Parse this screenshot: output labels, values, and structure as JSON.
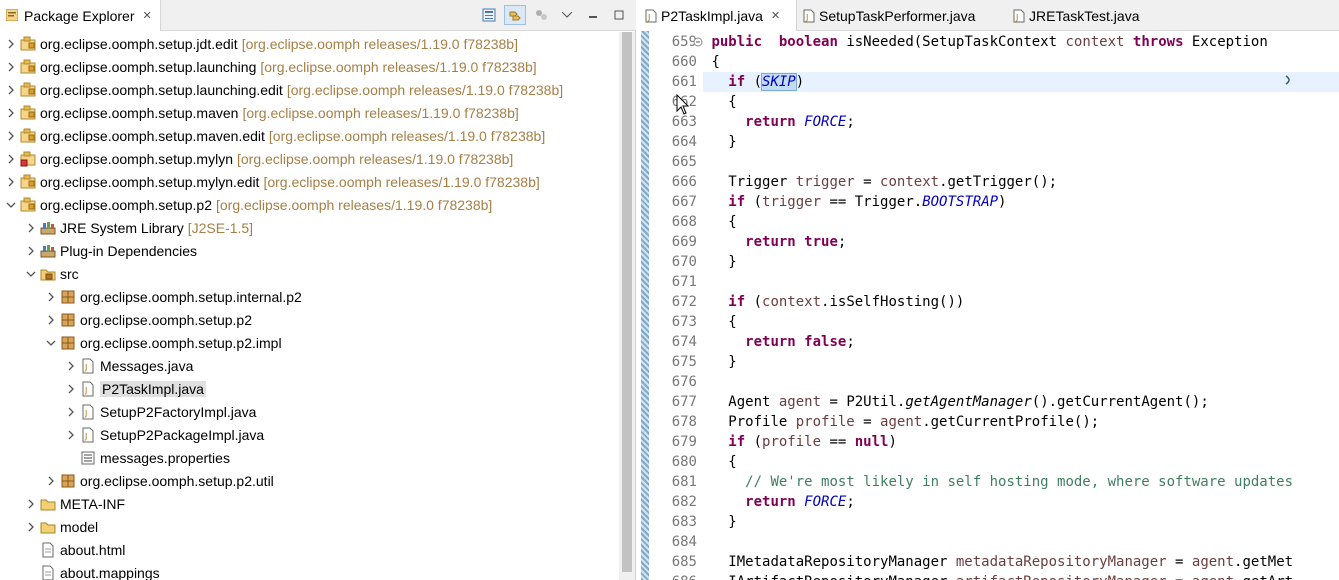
{
  "explorer": {
    "title": "Package Explorer",
    "close": "✕",
    "tree": [
      {
        "label": "org.eclipse.oomph.setup.jdt.edit",
        "decor": "[org.eclipse.oomph releases/1.19.0 f78238b]",
        "depth": 0,
        "expanded": false,
        "icon": "plugin-project-icon"
      },
      {
        "label": "org.eclipse.oomph.setup.launching",
        "decor": "[org.eclipse.oomph releases/1.19.0 f78238b]",
        "depth": 0,
        "expanded": false,
        "icon": "plugin-project-icon"
      },
      {
        "label": "org.eclipse.oomph.setup.launching.edit",
        "decor": "[org.eclipse.oomph releases/1.19.0 f78238b]",
        "depth": 0,
        "expanded": false,
        "icon": "plugin-project-icon"
      },
      {
        "label": "org.eclipse.oomph.setup.maven",
        "decor": "[org.eclipse.oomph releases/1.19.0 f78238b]",
        "depth": 0,
        "expanded": false,
        "icon": "plugin-project-icon"
      },
      {
        "label": "org.eclipse.oomph.setup.maven.edit",
        "decor": "[org.eclipse.oomph releases/1.19.0 f78238b]",
        "depth": 0,
        "expanded": false,
        "icon": "plugin-project-icon"
      },
      {
        "label": "org.eclipse.oomph.setup.mylyn",
        "decor": "[org.eclipse.oomph releases/1.19.0 f78238b]",
        "depth": 0,
        "expanded": false,
        "icon": "plugin-project-error-icon"
      },
      {
        "label": "org.eclipse.oomph.setup.mylyn.edit",
        "decor": "[org.eclipse.oomph releases/1.19.0 f78238b]",
        "depth": 0,
        "expanded": false,
        "icon": "plugin-project-icon"
      },
      {
        "label": "org.eclipse.oomph.setup.p2",
        "decor": "[org.eclipse.oomph releases/1.19.0 f78238b]",
        "depth": 0,
        "expanded": true,
        "icon": "plugin-project-icon"
      },
      {
        "label": "JRE System Library",
        "decor": "[J2SE-1.5]",
        "depth": 1,
        "expanded": false,
        "icon": "library-icon"
      },
      {
        "label": "Plug-in Dependencies",
        "decor": "",
        "depth": 1,
        "expanded": false,
        "icon": "library-icon"
      },
      {
        "label": "src",
        "decor": "",
        "depth": 1,
        "expanded": true,
        "icon": "source-folder-icon"
      },
      {
        "label": "org.eclipse.oomph.setup.internal.p2",
        "decor": "",
        "depth": 2,
        "expanded": false,
        "icon": "package-icon"
      },
      {
        "label": "org.eclipse.oomph.setup.p2",
        "decor": "",
        "depth": 2,
        "expanded": false,
        "icon": "package-icon"
      },
      {
        "label": "org.eclipse.oomph.setup.p2.impl",
        "decor": "",
        "depth": 2,
        "expanded": true,
        "icon": "package-icon"
      },
      {
        "label": "Messages.java",
        "decor": "",
        "depth": 3,
        "expanded": false,
        "icon": "java-file-icon"
      },
      {
        "label": "P2TaskImpl.java",
        "decor": "",
        "depth": 3,
        "expanded": false,
        "icon": "java-file-icon",
        "selected": true
      },
      {
        "label": "SetupP2FactoryImpl.java",
        "decor": "",
        "depth": 3,
        "expanded": false,
        "icon": "java-file-icon"
      },
      {
        "label": "SetupP2PackageImpl.java",
        "decor": "",
        "depth": 3,
        "expanded": false,
        "icon": "java-file-icon"
      },
      {
        "label": "messages.properties",
        "decor": "",
        "depth": 3,
        "expanded": null,
        "icon": "properties-file-icon"
      },
      {
        "label": "org.eclipse.oomph.setup.p2.util",
        "decor": "",
        "depth": 2,
        "expanded": false,
        "icon": "package-icon"
      },
      {
        "label": "META-INF",
        "decor": "",
        "depth": 1,
        "expanded": false,
        "icon": "folder-icon"
      },
      {
        "label": "model",
        "decor": "",
        "depth": 1,
        "expanded": false,
        "icon": "folder-icon"
      },
      {
        "label": "about.html",
        "decor": "",
        "depth": 1,
        "expanded": null,
        "icon": "file-icon"
      },
      {
        "label": "about.mappings",
        "decor": "",
        "depth": 1,
        "expanded": null,
        "icon": "file-icon"
      }
    ]
  },
  "editor": {
    "tabs": [
      {
        "label": "P2TaskImpl.java",
        "active": true
      },
      {
        "label": "SetupTaskPerformer.java",
        "active": false
      },
      {
        "label": "JRETaskTest.java",
        "active": false
      }
    ],
    "close": "✕",
    "lines": [
      {
        "n": "659",
        "fold": true,
        "tokens": [
          [
            "kw",
            "public"
          ],
          [
            "",
            "  "
          ],
          [
            "kw",
            "boolean"
          ],
          [
            "",
            " isNeeded(SetupTaskContext "
          ],
          [
            "var",
            "context"
          ],
          [
            "",
            " "
          ],
          [
            "kw",
            "throws"
          ],
          [
            "",
            " Exception"
          ]
        ]
      },
      {
        "n": "660",
        "tokens": [
          [
            "",
            "{"
          ]
        ]
      },
      {
        "n": "661",
        "current": true,
        "tokens": [
          [
            "",
            "  "
          ],
          [
            "kw",
            "if"
          ],
          [
            "",
            " ("
          ],
          [
            "fldhl",
            "SKIP"
          ],
          [
            "",
            ")"
          ]
        ]
      },
      {
        "n": "662",
        "tokens": [
          [
            "",
            "  {"
          ]
        ]
      },
      {
        "n": "663",
        "tokens": [
          [
            "",
            "    "
          ],
          [
            "kw",
            "return"
          ],
          [
            "",
            " "
          ],
          [
            "fld",
            "FORCE"
          ],
          [
            "",
            ";"
          ]
        ]
      },
      {
        "n": "664",
        "tokens": [
          [
            "",
            "  }"
          ]
        ]
      },
      {
        "n": "665",
        "tokens": [
          [
            "",
            ""
          ]
        ]
      },
      {
        "n": "666",
        "tokens": [
          [
            "",
            "  Trigger "
          ],
          [
            "var",
            "trigger"
          ],
          [
            "",
            " = "
          ],
          [
            "var",
            "context"
          ],
          [
            "",
            ".getTrigger();"
          ]
        ]
      },
      {
        "n": "667",
        "tokens": [
          [
            "",
            "  "
          ],
          [
            "kw",
            "if"
          ],
          [
            "",
            " ("
          ],
          [
            "var",
            "trigger"
          ],
          [
            "",
            " == Trigger."
          ],
          [
            "fld",
            "BOOTSTRAP"
          ],
          [
            "",
            ")"
          ]
        ]
      },
      {
        "n": "668",
        "tokens": [
          [
            "",
            "  {"
          ]
        ]
      },
      {
        "n": "669",
        "tokens": [
          [
            "",
            "    "
          ],
          [
            "kw",
            "return"
          ],
          [
            "",
            " "
          ],
          [
            "kw",
            "true"
          ],
          [
            "",
            ";"
          ]
        ]
      },
      {
        "n": "670",
        "tokens": [
          [
            "",
            "  }"
          ]
        ]
      },
      {
        "n": "671",
        "tokens": [
          [
            "",
            ""
          ]
        ]
      },
      {
        "n": "672",
        "tokens": [
          [
            "",
            "  "
          ],
          [
            "kw",
            "if"
          ],
          [
            "",
            " ("
          ],
          [
            "var",
            "context"
          ],
          [
            "",
            ".isSelfHosting())"
          ]
        ]
      },
      {
        "n": "673",
        "tokens": [
          [
            "",
            "  {"
          ]
        ]
      },
      {
        "n": "674",
        "tokens": [
          [
            "",
            "    "
          ],
          [
            "kw",
            "return"
          ],
          [
            "",
            " "
          ],
          [
            "kw",
            "false"
          ],
          [
            "",
            ";"
          ]
        ]
      },
      {
        "n": "675",
        "tokens": [
          [
            "",
            "  }"
          ]
        ]
      },
      {
        "n": "676",
        "tokens": [
          [
            "",
            ""
          ]
        ]
      },
      {
        "n": "677",
        "tokens": [
          [
            "",
            "  Agent "
          ],
          [
            "var",
            "agent"
          ],
          [
            "",
            " = P2Util."
          ],
          [
            "sm",
            "getAgentManager"
          ],
          [
            "",
            "().getCurrentAgent();"
          ]
        ]
      },
      {
        "n": "678",
        "tokens": [
          [
            "",
            "  Profile "
          ],
          [
            "var",
            "profile"
          ],
          [
            "",
            " = "
          ],
          [
            "var",
            "agent"
          ],
          [
            "",
            ".getCurrentProfile();"
          ]
        ]
      },
      {
        "n": "679",
        "tokens": [
          [
            "",
            "  "
          ],
          [
            "kw",
            "if"
          ],
          [
            "",
            " ("
          ],
          [
            "var",
            "profile"
          ],
          [
            "",
            " == "
          ],
          [
            "kw",
            "null"
          ],
          [
            "",
            ")"
          ]
        ]
      },
      {
        "n": "680",
        "tokens": [
          [
            "",
            "  {"
          ]
        ]
      },
      {
        "n": "681",
        "tokens": [
          [
            "",
            "    "
          ],
          [
            "cmt",
            "// We're most likely in self hosting mode, where software updates"
          ]
        ]
      },
      {
        "n": "682",
        "tokens": [
          [
            "",
            "    "
          ],
          [
            "kw",
            "return"
          ],
          [
            "",
            " "
          ],
          [
            "fld",
            "FORCE"
          ],
          [
            "",
            ";"
          ]
        ]
      },
      {
        "n": "683",
        "tokens": [
          [
            "",
            "  }"
          ]
        ]
      },
      {
        "n": "684",
        "tokens": [
          [
            "",
            ""
          ]
        ]
      },
      {
        "n": "685",
        "tokens": [
          [
            "",
            "  IMetadataRepositoryManager "
          ],
          [
            "var",
            "metadataRepositoryManager"
          ],
          [
            "",
            " = "
          ],
          [
            "var",
            "agent"
          ],
          [
            "",
            ".getMet"
          ]
        ]
      },
      {
        "n": "686",
        "tokens": [
          [
            "",
            "  IArtifactRepositoryManager "
          ],
          [
            "var",
            "artifactRepositoryManager"
          ],
          [
            "",
            " = "
          ],
          [
            "var",
            "agent"
          ],
          [
            "",
            ".getArt"
          ]
        ]
      }
    ]
  }
}
